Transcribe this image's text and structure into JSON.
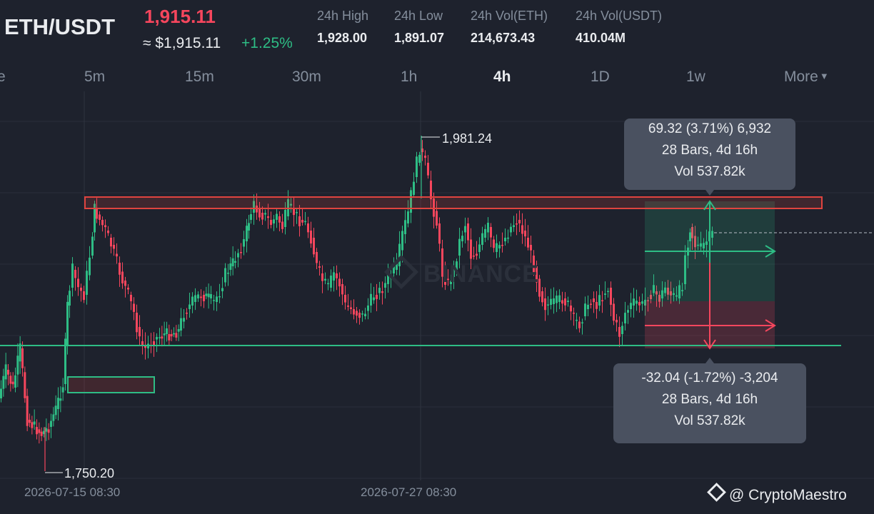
{
  "header": {
    "pair": "ETH/USDT",
    "price": "1,915.11",
    "price_usd": "≈ $1,915.11",
    "change": "+1.25%",
    "stats": [
      {
        "label": "24h High",
        "value": "1,928.00"
      },
      {
        "label": "24h Low",
        "value": "1,891.07"
      },
      {
        "label": "24h Vol(ETH)",
        "value": "214,673.43"
      },
      {
        "label": "24h Vol(USDT)",
        "value": "410.04M"
      }
    ]
  },
  "intervals": {
    "items": [
      "e",
      "5m",
      "15m",
      "30m",
      "1h",
      "4h",
      "1D",
      "1w"
    ],
    "active": "4h",
    "more_label": "More"
  },
  "chart": {
    "high_label": "1,981.24",
    "low_label": "1,750.20",
    "time_labels": [
      "2026-07-15 08:30",
      "2026-07-27 08:30"
    ],
    "watermark": "BINANCE",
    "long_tooltip": [
      "69.32 (3.71%) 6,932",
      "28 Bars, 4d 16h",
      "Vol 537.82k"
    ],
    "short_tooltip": [
      "-32.04 (-1.72%) -3,204",
      "28 Bars, 4d 16h",
      "Vol 537.82k"
    ]
  },
  "footer": {
    "author": "@ CryptoMaestro"
  },
  "colors": {
    "background": "#1e222d",
    "up": "#2ebd85",
    "down": "#f6465d",
    "text": "#eaecef",
    "muted": "#848e9c",
    "resistance": "#e0443f",
    "support": "#2ebd85"
  }
}
